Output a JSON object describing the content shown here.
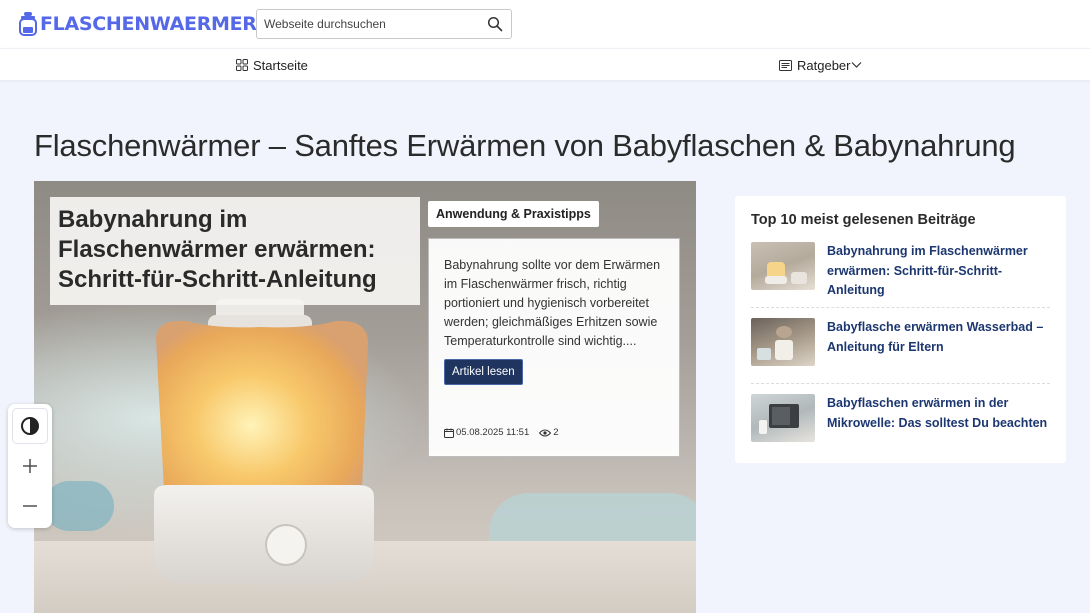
{
  "header": {
    "logo_text": "FLASCHENWAERMER",
    "search_placeholder": "Webseite durchsuchen"
  },
  "nav": {
    "home_label": "Startseite",
    "ratgeber_label": "Ratgeber"
  },
  "page_title": "Flaschenwärmer – Sanftes Erwärmen von Babyflaschen & Babynahrung",
  "hero": {
    "headline": "Babynahrung im Flaschenwärmer erwärmen: Schritt-für-Schritt-Anleitung",
    "category": "Anwendung & Praxistipps",
    "excerpt": "Babynahrung sollte vor dem Erwärmen im Flaschenwärmer frisch, richtig portioniert und hygienisch vorbereitet werden; gleichmäßiges Erhitzen sowie Temperaturkontrolle sind wichtig....",
    "read_more": "Artikel lesen",
    "date": "05.08.2025 11:51",
    "views": "2"
  },
  "sidebar": {
    "title": "Top 10 meist gelesenen Beiträge",
    "items": [
      {
        "title": "Babynahrung im Flaschenwärmer erwärmen: Schritt-für-Schritt-Anleitung"
      },
      {
        "title": "Babyflasche erwärmen Wasserbad – Anleitung für Eltern"
      },
      {
        "title": "Babyflaschen erwärmen in der Mikrowelle: Das solltest Du beachten"
      }
    ]
  },
  "colors": {
    "brand": "#5468e8",
    "link": "#1c3770",
    "button": "#1f3560",
    "background": "#f1f4fd"
  }
}
